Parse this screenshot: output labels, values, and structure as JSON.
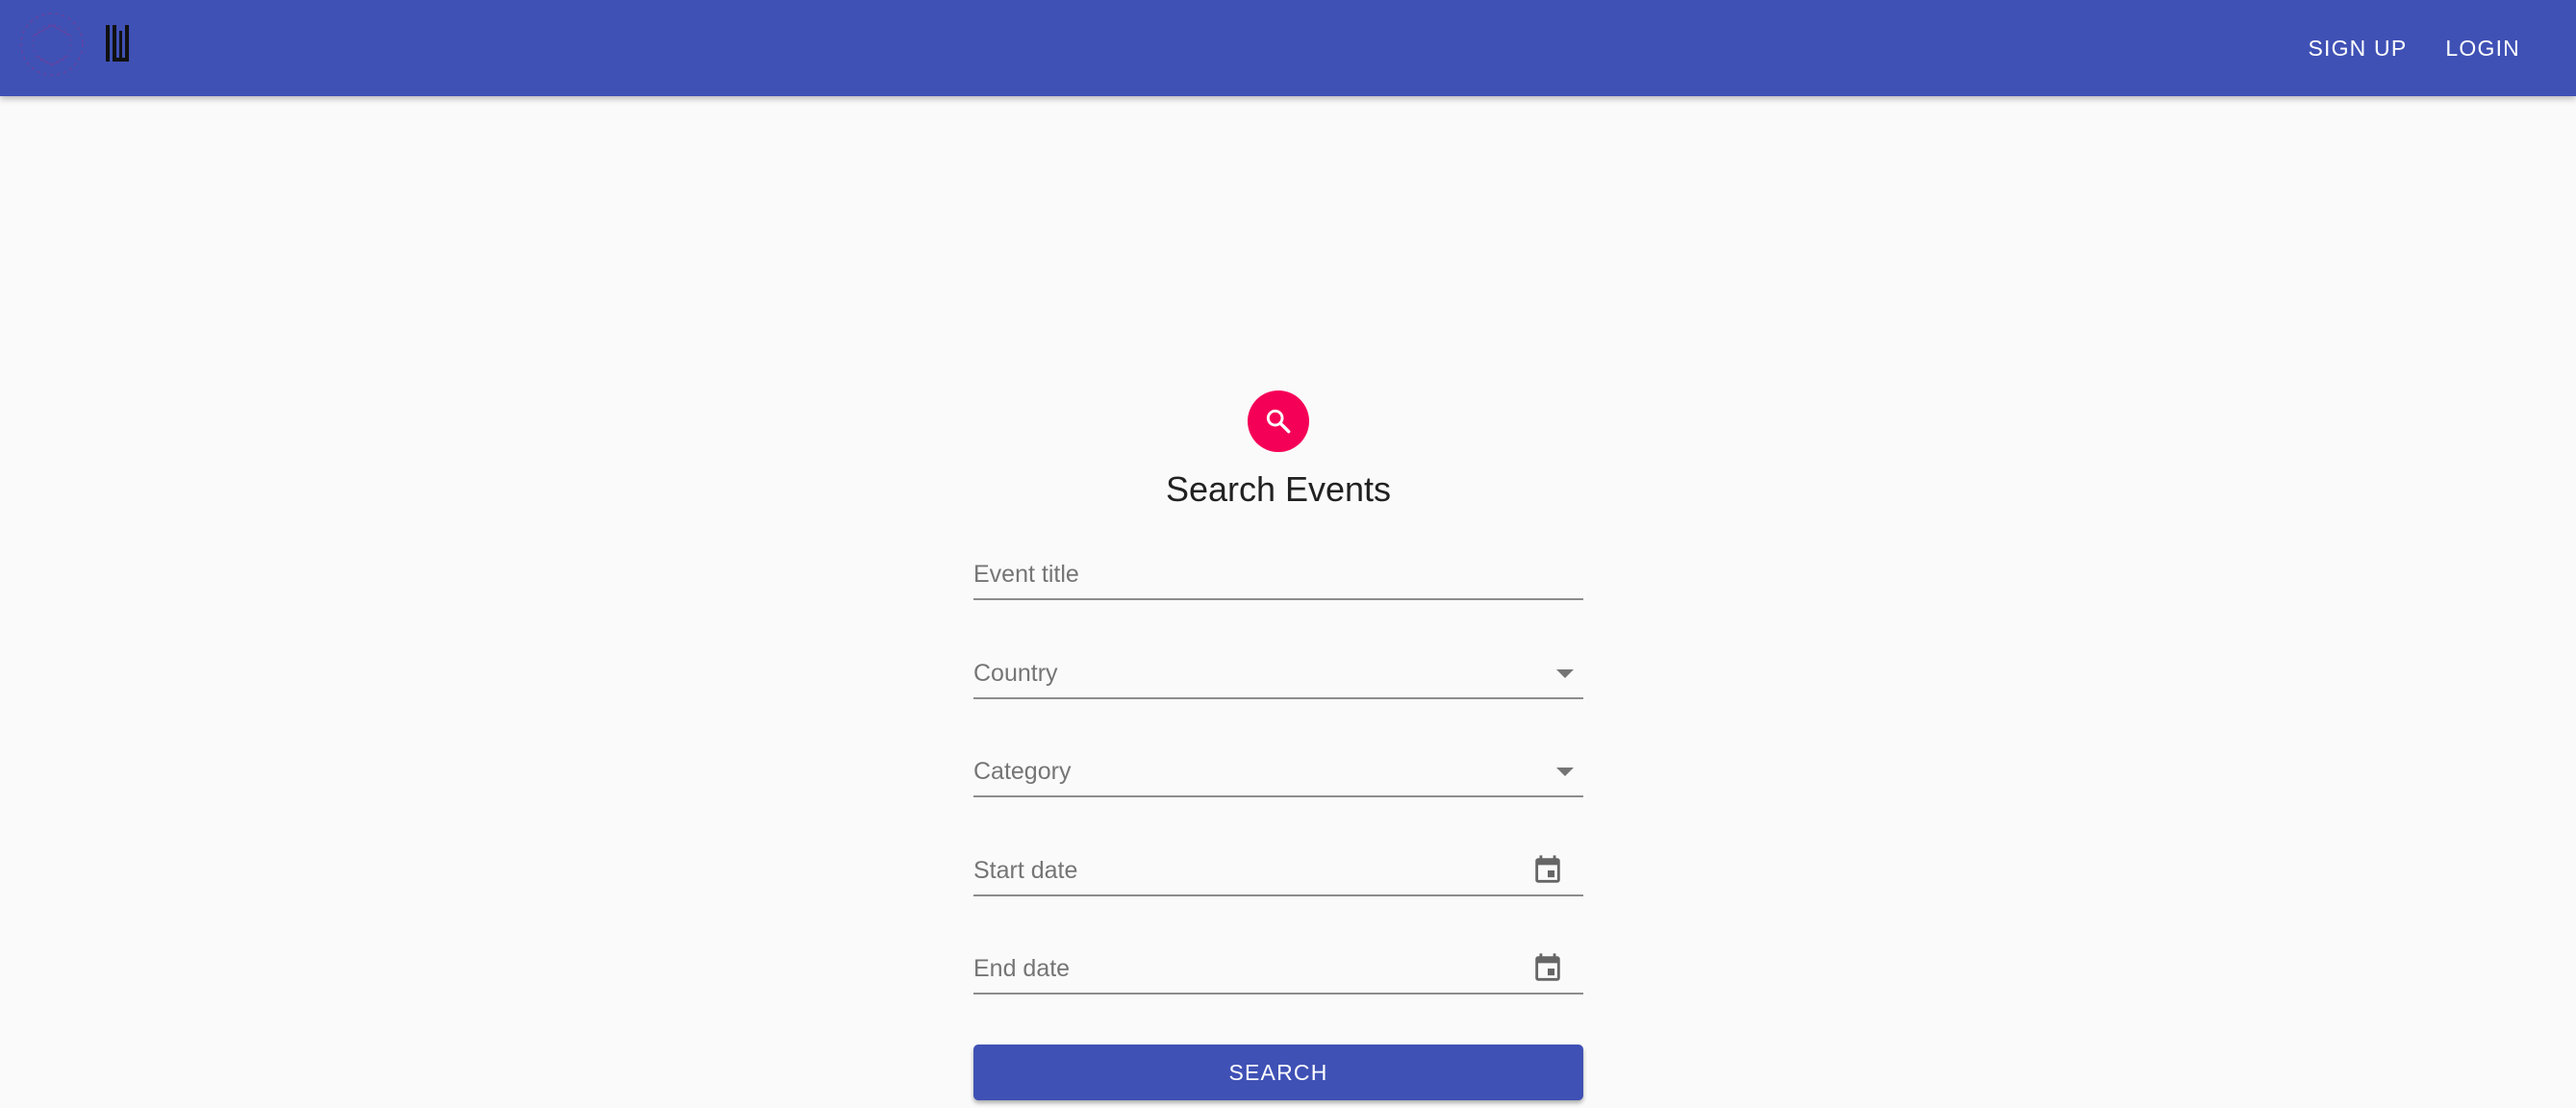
{
  "header": {
    "nav": {
      "signup_label": "SIGN UP",
      "login_label": "LOGIN"
    }
  },
  "form": {
    "title": "Search Events",
    "fields": {
      "event_title": {
        "placeholder": "Event title",
        "value": ""
      },
      "country": {
        "placeholder": "Country",
        "value": ""
      },
      "category": {
        "placeholder": "Category",
        "value": ""
      },
      "start_date": {
        "placeholder": "Start date",
        "value": ""
      },
      "end_date": {
        "placeholder": "End date",
        "value": ""
      }
    },
    "submit_label": "SEARCH"
  },
  "icons": {
    "avatar": "search-icon",
    "date_picker": "calendar-icon",
    "select": "arrow-drop-down-icon"
  },
  "colors": {
    "primary": "#3f51b5",
    "secondary": "#f50057",
    "background": "#fafafa"
  }
}
